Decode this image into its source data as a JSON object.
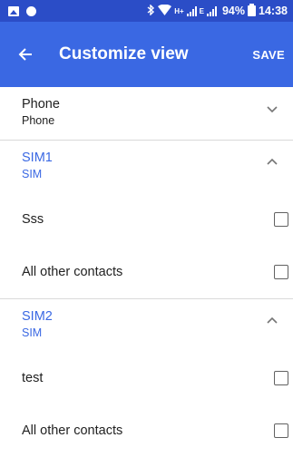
{
  "status_bar": {
    "network_label": "H+",
    "network_label_2": "E",
    "battery": "94%",
    "time": "14:38",
    "icons": [
      "image-icon",
      "circle-icon",
      "bluetooth-icon",
      "wifi-icon",
      "signal-icon",
      "battery-icon"
    ]
  },
  "app_bar": {
    "title": "Customize view",
    "save_label": "SAVE",
    "back_icon": "arrow-left-icon"
  },
  "accounts": [
    {
      "title": "Phone",
      "subtitle": "Phone",
      "expanded": false,
      "highlight": false,
      "items": []
    },
    {
      "title": "SIM1",
      "subtitle": "SIM",
      "expanded": true,
      "highlight": true,
      "items": [
        {
          "label": "Sss",
          "checked": false
        },
        {
          "label": "All other contacts",
          "checked": false
        }
      ]
    },
    {
      "title": "SIM2",
      "subtitle": "SIM",
      "expanded": true,
      "highlight": true,
      "items": [
        {
          "label": "test",
          "checked": false
        },
        {
          "label": "All other contacts",
          "checked": false
        }
      ]
    }
  ],
  "colors": {
    "status_bar": "#2b4dc7",
    "app_bar": "#3a68e3",
    "accent": "#3a68e3",
    "text": "#212121"
  }
}
